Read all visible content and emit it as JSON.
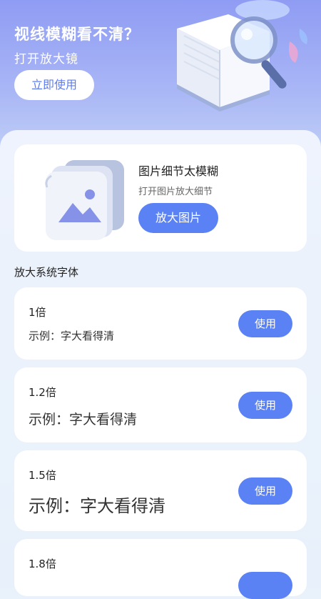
{
  "hero": {
    "title": "视线模糊看不清？",
    "subtitle": "打开放大镜",
    "button_label": "立即使用",
    "art_icon": "book-magnifier-illustration"
  },
  "image_card": {
    "title": "图片细节太模糊",
    "description": "打开图片放大细节",
    "button_label": "放大图片",
    "art_icon": "picture-icon"
  },
  "section_title": "放大系统字体",
  "font_options": [
    {
      "multiplier": "1倍",
      "example": "示例：字大看得清",
      "button_label": "使用"
    },
    {
      "multiplier": "1.2倍",
      "example": "示例：字大看得清",
      "button_label": "使用"
    },
    {
      "multiplier": "1.5倍",
      "example": "示例：字大看得清",
      "button_label": "使用"
    },
    {
      "multiplier": "1.8倍",
      "example": "",
      "button_label": ""
    }
  ],
  "colors": {
    "accent": "#5b82f4",
    "hero_top": "#8f9cf3",
    "panel_bg": "#e9f1fb"
  }
}
